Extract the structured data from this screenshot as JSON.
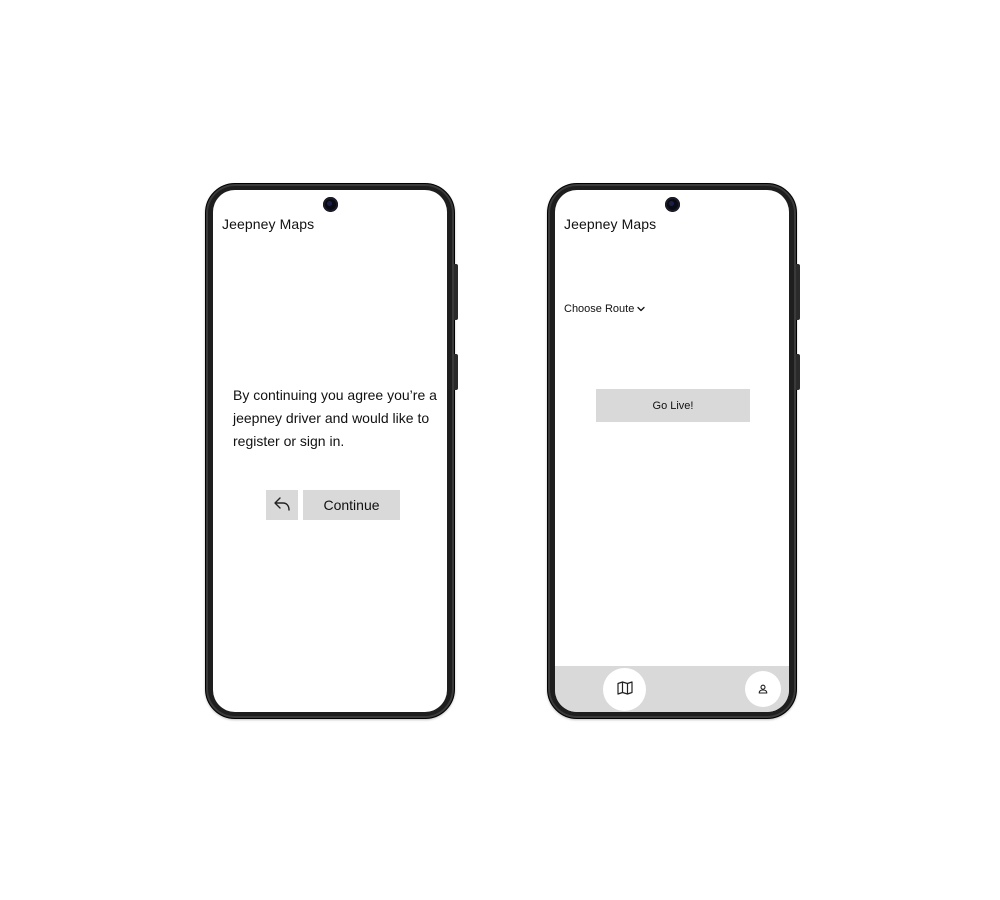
{
  "screens": [
    {
      "app_title": "Jeepney Maps",
      "consent_text": "By continuing you agree you’re a jeepney driver and would like to register or sign in.",
      "back_icon": "reply-arrow-icon",
      "continue_label": "Continue"
    },
    {
      "app_title": "Jeepney Maps",
      "route_select_label": "Choose Route",
      "route_select_icon": "chevron-down-icon",
      "go_live_label": "Go Live!",
      "nav": {
        "map_icon": "map-icon",
        "profile_icon": "user-icon"
      }
    }
  ],
  "colors": {
    "button_bg": "#d9d9d9",
    "nav_bg": "#d9d9d9",
    "text": "#111111",
    "phone_frame": "#1e1e1e"
  }
}
